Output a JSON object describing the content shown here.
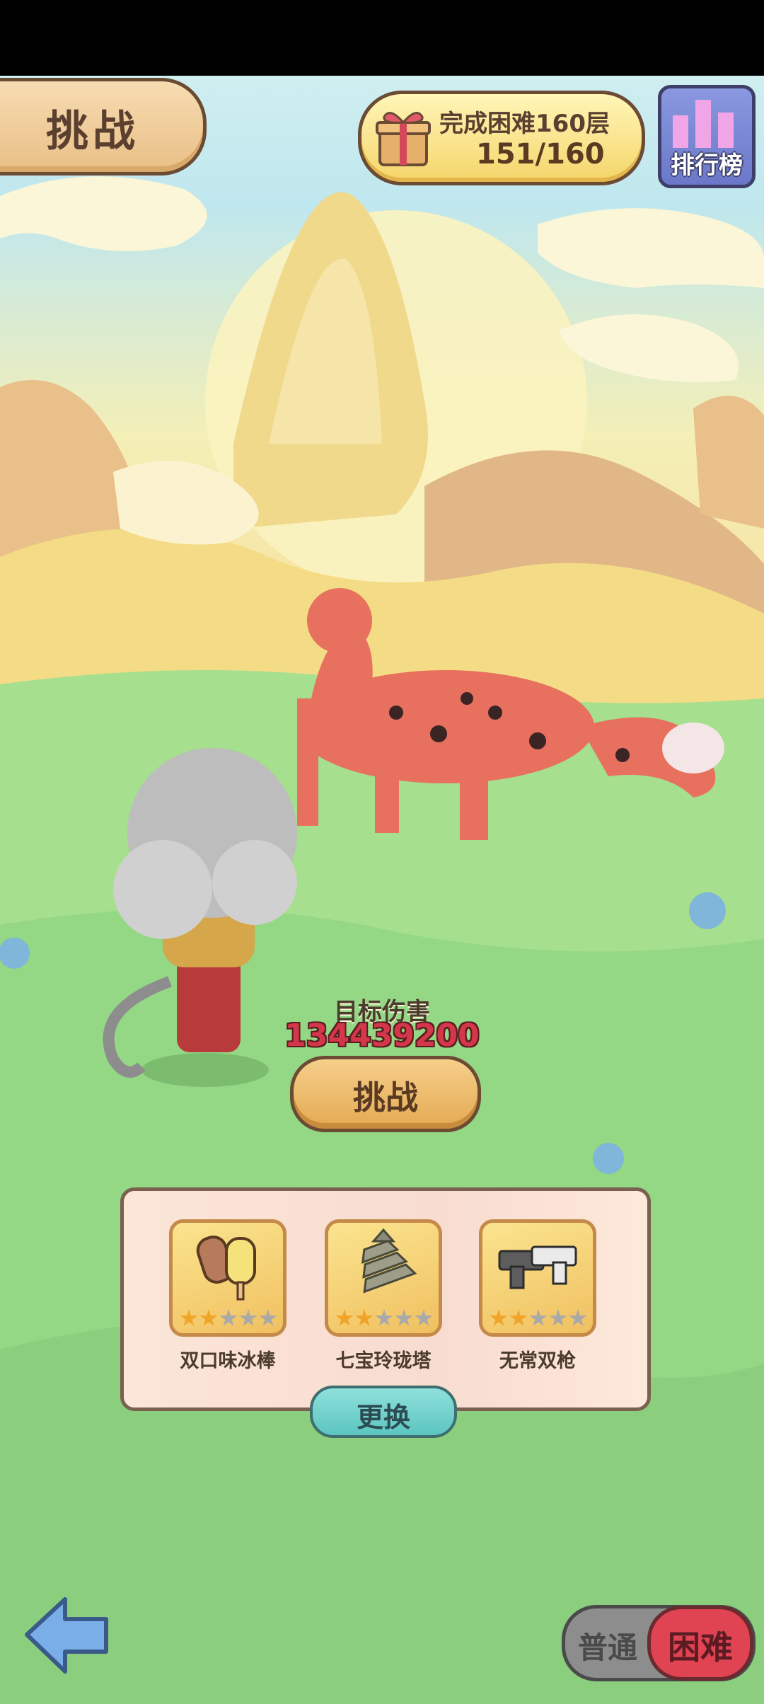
{
  "header": {
    "title": "挑战",
    "goal_text": "完成困难160层",
    "goal_progress": "151/160",
    "goal_fraction": 0.944,
    "ranking_label": "排行榜"
  },
  "battle": {
    "damage_label": "目标伤害",
    "damage_value": "134439200",
    "challenge_button": "挑战"
  },
  "items": [
    {
      "name": "双口味冰棒",
      "stars": 2,
      "max_stars": 5,
      "icon": "popsicle-icon"
    },
    {
      "name": "七宝玲珑塔",
      "stars": 2,
      "max_stars": 5,
      "icon": "pagoda-icon"
    },
    {
      "name": "无常双枪",
      "stars": 2,
      "max_stars": 5,
      "icon": "twin-guns-icon"
    }
  ],
  "swap_button": "更换",
  "mode": {
    "normal_label": "普通",
    "hard_label": "困难",
    "selected": "困难"
  },
  "colors": {
    "accent_hard": "#e04352",
    "button_gold": "#e4a953",
    "swap_teal": "#5cc5c0",
    "damage_red": "#d4364a"
  }
}
